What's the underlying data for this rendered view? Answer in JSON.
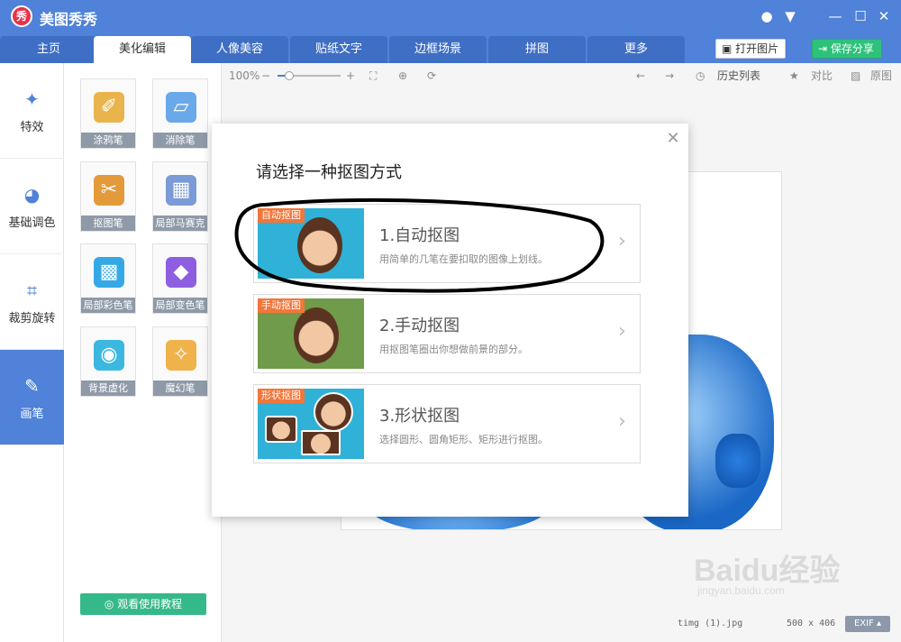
{
  "app": {
    "title": "美图秀秀",
    "logo_text": "秀"
  },
  "tabs": [
    "主页",
    "美化编辑",
    "人像美容",
    "贴纸文字",
    "边框场景",
    "拼图",
    "更多"
  ],
  "header": {
    "open_label": "打开图片",
    "save_label": "保存分享"
  },
  "sidebar": {
    "items": [
      {
        "label": "特效",
        "icon": "magic-wand-icon"
      },
      {
        "label": "基础调色",
        "icon": "palette-icon"
      },
      {
        "label": "裁剪旋转",
        "icon": "crop-icon"
      },
      {
        "label": "画笔",
        "icon": "brush-icon"
      }
    ]
  },
  "tools": [
    {
      "label": "涂鸦笔",
      "icon": "paintbrush-icon"
    },
    {
      "label": "消除笔",
      "icon": "eraser-icon"
    },
    {
      "label": "抠图笔",
      "icon": "cutout-brush-icon"
    },
    {
      "label": "局部马赛克",
      "icon": "mosaic-icon"
    },
    {
      "label": "局部彩色笔",
      "icon": "color-pen-icon"
    },
    {
      "label": "局部变色笔",
      "icon": "recolor-pen-icon"
    },
    {
      "label": "背景虚化",
      "icon": "blur-icon"
    },
    {
      "label": "魔幻笔",
      "icon": "magic-pen-icon"
    }
  ],
  "tutorial_label": "观看使用教程",
  "toolbar": {
    "zoom": "100%",
    "zoom_level": 0.18,
    "history_label": "历史列表",
    "compare_label": "对比",
    "original_label": "原图"
  },
  "modal": {
    "title": "请选择一种抠图方式",
    "options": [
      {
        "tag": "自动抠图",
        "title": "1.自动抠图",
        "desc": "用简单的几笔在要扣取的图像上划线。"
      },
      {
        "tag": "手动抠图",
        "title": "2.手动抠图",
        "desc": "用抠图笔圈出你想做前景的部分。"
      },
      {
        "tag": "形状抠图",
        "title": "3.形状抠图",
        "desc": "选择圆形、圆角矩形、矩形进行抠图。"
      }
    ]
  },
  "status": {
    "filename": "timg (1).jpg",
    "dimensions": "500 x 406",
    "exif_label": "EXIF"
  },
  "watermark": {
    "brand": "Baidu经验",
    "url": "jingyan.baidu.com"
  },
  "colors": {
    "primary": "#4f82d8",
    "save_green": "#2ec17b",
    "tag_orange": "#f2763a"
  }
}
